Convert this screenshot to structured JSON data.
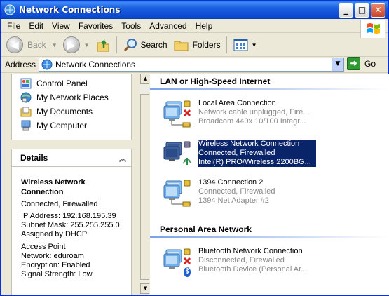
{
  "window": {
    "title": "Network Connections",
    "controls": [
      "_",
      "□",
      "✕"
    ]
  },
  "menu": [
    "File",
    "Edit",
    "View",
    "Favorites",
    "Tools",
    "Advanced",
    "Help"
  ],
  "toolbar": {
    "back": "Back",
    "search": "Search",
    "folders": "Folders"
  },
  "address": {
    "label": "Address",
    "value": "Network Connections",
    "go": "Go"
  },
  "other_places": [
    {
      "label": "Control Panel",
      "icon": "control-panel-icon"
    },
    {
      "label": "My Network Places",
      "icon": "network-places-icon"
    },
    {
      "label": "My Documents",
      "icon": "my-documents-icon"
    },
    {
      "label": "My Computer",
      "icon": "my-computer-icon"
    }
  ],
  "details": {
    "heading": "Details",
    "name_line1": "Wireless Network",
    "name_line2": "Connection",
    "status": "Connected, Firewalled",
    "ip": "IP Address: 192.168.195.39",
    "mask": "Subnet Mask: 255.255.255.0",
    "assigned": "Assigned by DHCP",
    "ap": "Access Point",
    "network": "Network: eduroam",
    "encryption": "Encryption: Enabled",
    "signal": "Signal Strength: Low"
  },
  "groups": {
    "lan_title": "LAN or High-Speed Internet",
    "pan_title": "Personal Area Network"
  },
  "connections": {
    "local": {
      "name": "Local Area Connection",
      "status": "Network cable unplugged, Fire...",
      "device": "Broadcom 440x 10/100 Integr..."
    },
    "wireless": {
      "name": "Wireless Network Connection",
      "status": "Connected, Firewalled",
      "device": "Intel(R) PRO/Wireless 2200BG..."
    },
    "fw1394": {
      "name": "1394 Connection 2",
      "status": "Connected, Firewalled",
      "device": "1394 Net Adapter #2"
    },
    "bluetooth": {
      "name": "Bluetooth Network Connection",
      "status": "Disconnected, Firewalled",
      "device": "Bluetooth Device (Personal Ar..."
    }
  },
  "colors": {
    "title_blue": "#0c49cf",
    "selection": "#0a246a",
    "pane_gradient_top": "#7ba2e7",
    "pane_gradient_bottom": "#6375d6"
  }
}
